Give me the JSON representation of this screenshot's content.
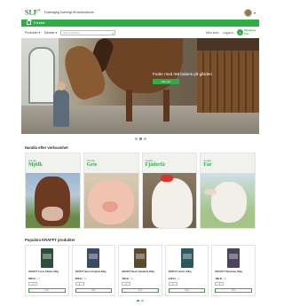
{
  "header": {
    "logo": "SLF",
    "logo_mark": "®",
    "tagline": "Foderagtig foderrigt till landmännen",
    "avatar_dropdown": "▾"
  },
  "nav": {
    "home_label": "Förside"
  },
  "toolbar": {
    "menu_products": "Produkter ▾",
    "menu_service": "Tjänster ▾",
    "search_placeholder": "Sök produkter",
    "right_links": [
      "Mina sidor",
      "Logga in"
    ],
    "cart_count": "0",
    "cart_label_line1": "Varukorg",
    "cart_label_line2": "0 kr"
  },
  "hero": {
    "headline": "Foder med rätt balans på gården",
    "cta_label": "Läs mer",
    "slides": 3,
    "active_slide": 1
  },
  "animals_section": {
    "title": "Handla efter verksamhet",
    "cards": [
      {
        "kicker": "Handla",
        "name": "Mjölk",
        "kind": "cow"
      },
      {
        "kicker": "Handla",
        "name": "Gris",
        "kind": "pig"
      },
      {
        "kicker": "Handla",
        "name": "Fjäderfä",
        "kind": "hen"
      },
      {
        "kicker": "Handla",
        "name": "Får",
        "kind": "sheep"
      }
    ]
  },
  "products_section": {
    "title": "Populära KRAFFT produkter",
    "items": [
      {
        "name": "KRAFFT Cover Pellets 20kg",
        "price": "189 kr",
        "unit": "/ st",
        "qty": "1",
        "buy": "Köp"
      },
      {
        "name": "KRAFFT Sport Original 20kg",
        "price": "229 kr",
        "unit": "/ st",
        "qty": "1",
        "buy": "Köp"
      },
      {
        "name": "KRAFFT Basic Standard 20kg",
        "price": "169 kr",
        "unit": "/ st",
        "qty": "1",
        "buy": "Köp"
      },
      {
        "name": "KRAFFT Senior 20kg",
        "price": "219 kr",
        "unit": "/ st",
        "qty": "1",
        "buy": "Köp"
      },
      {
        "name": "KRAFFT Fiberfoder 20kg",
        "price": "199 kr",
        "unit": "/ st",
        "qty": "1",
        "buy": "Köp"
      }
    ],
    "slides": 2,
    "active_slide": 1
  },
  "colors": {
    "brand_green": "#2fae45",
    "text_dark": "#333333"
  }
}
